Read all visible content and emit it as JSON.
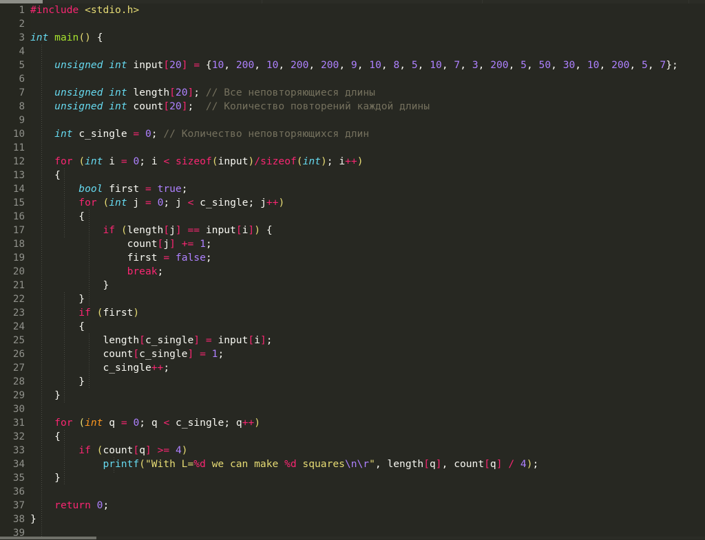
{
  "editor": {
    "theme_name": "monokai",
    "background": "#272822",
    "gutter_background": "#262720",
    "foreground": "#f8f8f2",
    "language": "c",
    "total_lines": 39,
    "first_visible_line": 1,
    "colors": {
      "keyword": "#f92672",
      "type": "#66d9ef",
      "type_alt": "#fd971f",
      "function": "#a6e22e",
      "number": "#ae81ff",
      "string": "#e6db74",
      "comment": "#75715e",
      "linenumber": "#90918b"
    }
  },
  "scrollbars": {
    "top_thumb_label": "horizontal-scroll-thumb",
    "bottom_thumb_label": "horizontal-scroll-thumb"
  },
  "line_numbers": [
    "1",
    "2",
    "3",
    "4",
    "5",
    "6",
    "7",
    "8",
    "9",
    "10",
    "11",
    "12",
    "13",
    "14",
    "15",
    "16",
    "17",
    "18",
    "19",
    "20",
    "21",
    "22",
    "23",
    "24",
    "25",
    "26",
    "27",
    "28",
    "29",
    "30",
    "31",
    "32",
    "33",
    "34",
    "35",
    "36",
    "37",
    "38",
    "39"
  ],
  "code_lines": [
    {
      "n": 1,
      "text": "#include <stdio.h>"
    },
    {
      "n": 2,
      "text": ""
    },
    {
      "n": 3,
      "text": "int main() {"
    },
    {
      "n": 4,
      "text": ""
    },
    {
      "n": 5,
      "text": "    unsigned int input[20] = {10, 200, 10, 200, 200, 9, 10, 8, 5, 10, 7, 3, 200, 5, 50, 30, 10, 200, 5, 7};"
    },
    {
      "n": 6,
      "text": ""
    },
    {
      "n": 7,
      "text": "    unsigned int length[20]; // Все неповторяющиеся длины"
    },
    {
      "n": 8,
      "text": "    unsigned int count[20];  // Количество повторений каждой длины"
    },
    {
      "n": 9,
      "text": ""
    },
    {
      "n": 10,
      "text": "    int c_single = 0; // Количество неповторяющихся длин"
    },
    {
      "n": 11,
      "text": ""
    },
    {
      "n": 12,
      "text": "    for (int i = 0; i < sizeof(input)/sizeof(int); i++)"
    },
    {
      "n": 13,
      "text": "    {"
    },
    {
      "n": 14,
      "text": "        bool first = true;"
    },
    {
      "n": 15,
      "text": "        for (int j = 0; j < c_single; j++)"
    },
    {
      "n": 16,
      "text": "        {"
    },
    {
      "n": 17,
      "text": "            if (length[j] == input[i]) {"
    },
    {
      "n": 18,
      "text": "                count[j] += 1;"
    },
    {
      "n": 19,
      "text": "                first = false;"
    },
    {
      "n": 20,
      "text": "                break;"
    },
    {
      "n": 21,
      "text": "            }"
    },
    {
      "n": 22,
      "text": "        }"
    },
    {
      "n": 23,
      "text": "        if (first)"
    },
    {
      "n": 24,
      "text": "        {"
    },
    {
      "n": 25,
      "text": "            length[c_single] = input[i];"
    },
    {
      "n": 26,
      "text": "            count[c_single] = 1;"
    },
    {
      "n": 27,
      "text": "            c_single++;"
    },
    {
      "n": 28,
      "text": "        }"
    },
    {
      "n": 29,
      "text": "    }"
    },
    {
      "n": 30,
      "text": ""
    },
    {
      "n": 31,
      "text": "    for (int q = 0; q < c_single; q++)"
    },
    {
      "n": 32,
      "text": "    {"
    },
    {
      "n": 33,
      "text": "        if (count[q] >= 4)"
    },
    {
      "n": 34,
      "text": "            printf(\"With L=%d we can make %d squares\\n\\r\", length[q], count[q] / 4);"
    },
    {
      "n": 35,
      "text": "    }"
    },
    {
      "n": 36,
      "text": ""
    },
    {
      "n": 37,
      "text": "    return 0;"
    },
    {
      "n": 38,
      "text": "}"
    },
    {
      "n": 39,
      "text": ""
    }
  ],
  "tokens": {
    "include_directive": "#include",
    "include_path": "<stdio.h>",
    "main_name": "main",
    "printf_name": "printf",
    "printf_string": "\"With L=%d we can make %d squares\\n\\r\"",
    "comment_line7": "// Все неповторяющиеся длины",
    "comment_line8": "// Количество повторений каждой длины",
    "comment_line10": "// Количество неповторяющихся длин",
    "array_literal": "{10, 200, 10, 200, 200, 9, 10, 8, 5, 10, 7, 3, 200, 5, 50, 30, 10, 200, 5, 7}",
    "array_values": [
      10,
      200,
      10,
      200,
      200,
      9,
      10,
      8,
      5,
      10,
      7,
      3,
      200,
      5,
      50,
      30,
      10,
      200,
      5,
      7
    ],
    "array_size": 20
  }
}
